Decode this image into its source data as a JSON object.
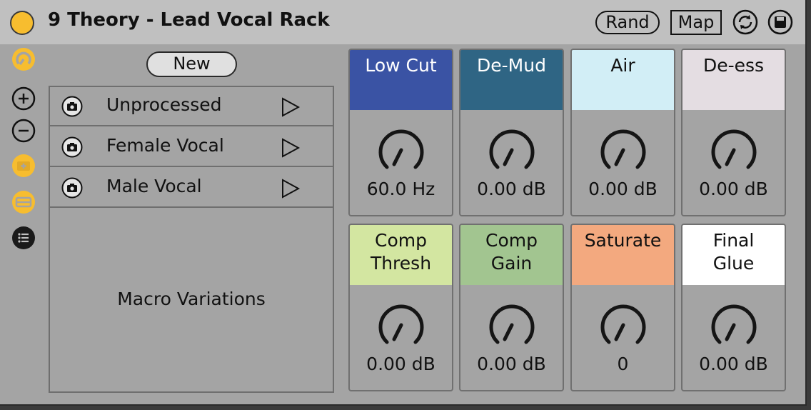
{
  "header": {
    "title": "9 Theory - Lead Vocal Rack",
    "rand_label": "Rand",
    "map_label": "Map"
  },
  "sidebar": {
    "icons": [
      "knob-mapping-icon",
      "plus-icon",
      "minus-icon",
      "add-variation-icon",
      "remove-variation-icon",
      "list-icon"
    ]
  },
  "variations": {
    "new_label": "New",
    "items": [
      {
        "label": "Unprocessed"
      },
      {
        "label": "Female Vocal"
      },
      {
        "label": "Male Vocal"
      }
    ],
    "panel_label": "Macro Variations"
  },
  "macros": [
    {
      "label": "Low Cut",
      "value": "60.0 Hz",
      "color": "#3a53a4",
      "text_color": "#ffffff"
    },
    {
      "label": "De-Mud",
      "value": "0.00 dB",
      "color": "#2f6584",
      "text_color": "#ffffff"
    },
    {
      "label": "Air",
      "value": "0.00 dB",
      "color": "#d2eef6",
      "text_color": "#111111"
    },
    {
      "label": "De-ess",
      "value": "0.00 dB",
      "color": "#e4dde2",
      "text_color": "#111111"
    },
    {
      "label": "Comp\nThresh",
      "value": "0.00 dB",
      "color": "#d3e6a1",
      "text_color": "#111111"
    },
    {
      "label": "Comp\nGain",
      "value": "0.00 dB",
      "color": "#a2c590",
      "text_color": "#111111"
    },
    {
      "label": "Saturate",
      "value": "0",
      "color": "#f3a97f",
      "text_color": "#111111"
    },
    {
      "label": "Final\nGlue",
      "value": "0.00 dB",
      "color": "#ffffff",
      "text_color": "#111111"
    }
  ],
  "colors": {
    "accent": "#f7bd2f",
    "panel": "#a4a4a4",
    "titlebar": "#c0c0c0"
  }
}
